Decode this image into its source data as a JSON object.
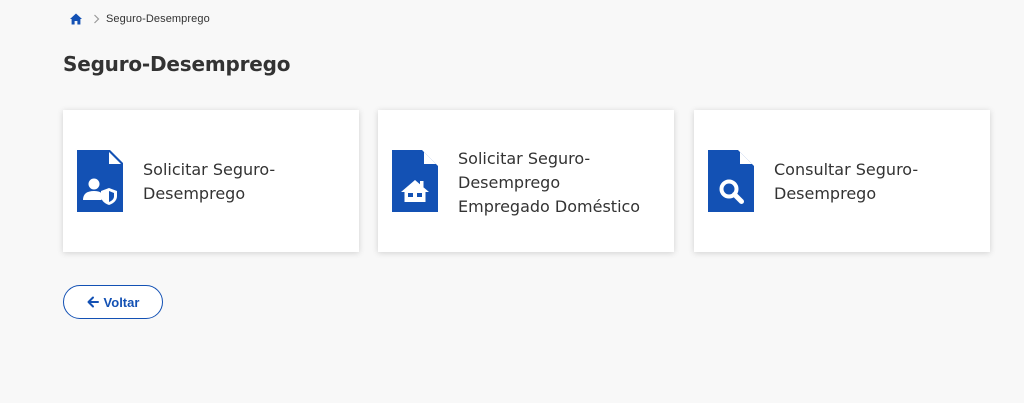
{
  "breadcrumb": {
    "home_icon": "home-icon",
    "separator_icon": "chevron-right-icon",
    "current": "Seguro-Desemprego"
  },
  "title": "Seguro-Desemprego",
  "cards": [
    {
      "icon": "document-user-shield-icon",
      "lines": [
        "Solicitar Seguro-",
        "Desemprego"
      ]
    },
    {
      "icon": "document-house-icon",
      "lines": [
        "Solicitar Seguro-",
        "Desemprego",
        "Empregado Doméstico"
      ]
    },
    {
      "icon": "document-search-icon",
      "lines": [
        "Consultar Seguro-",
        "Desemprego"
      ]
    }
  ],
  "back_button": {
    "label": "Voltar",
    "icon": "arrow-left-icon"
  },
  "colors": {
    "accent": "#1351b4",
    "background": "#f8f8f8",
    "card": "#ffffff",
    "text": "#333333"
  }
}
